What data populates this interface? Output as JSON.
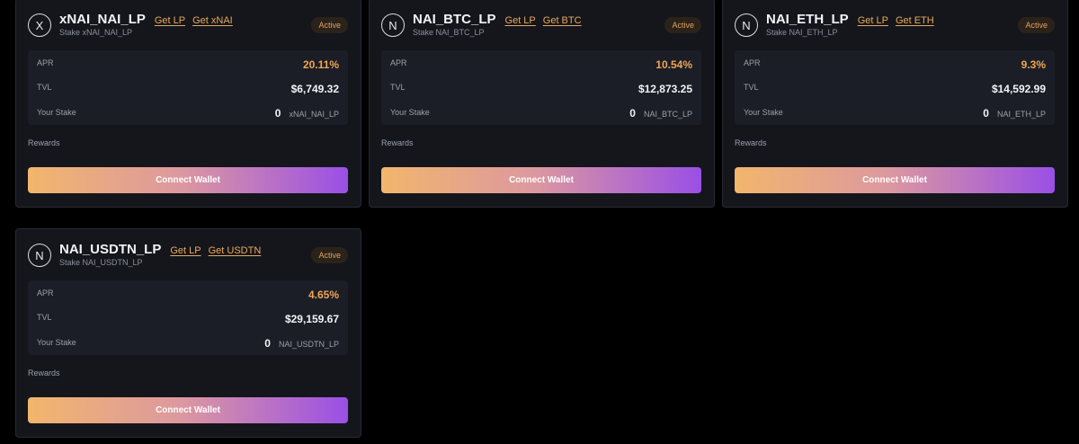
{
  "pools": [
    {
      "icon_letter": "X",
      "icon": "letter-circle-icon",
      "title": "xNAI_NAI_LP",
      "get_lp_label": "Get LP",
      "get_token_label": "Get xNAI",
      "subtitle": "Stake xNAI_NAI_LP",
      "status": "Active",
      "apr_label": "APR",
      "apr_value": "20.11%",
      "tvl_label": "TVL",
      "tvl_value": "$6,749.32",
      "stake_label": "Your Stake",
      "stake_amount": "0",
      "stake_token": "xNAI_NAI_LP",
      "rewards_label": "Rewards",
      "button_label": "Connect Wallet"
    },
    {
      "icon_letter": "N",
      "icon": "letter-circle-icon",
      "title": "NAI_BTC_LP",
      "get_lp_label": "Get LP",
      "get_token_label": "Get BTC",
      "subtitle": "Stake NAI_BTC_LP",
      "status": "Active",
      "apr_label": "APR",
      "apr_value": "10.54%",
      "tvl_label": "TVL",
      "tvl_value": "$12,873.25",
      "stake_label": "Your Stake",
      "stake_amount": "0",
      "stake_token": "NAI_BTC_LP",
      "rewards_label": "Rewards",
      "button_label": "Connect Wallet"
    },
    {
      "icon_letter": "N",
      "icon": "letter-circle-icon",
      "title": "NAI_ETH_LP",
      "get_lp_label": "Get LP",
      "get_token_label": "Get ETH",
      "subtitle": "Stake NAI_ETH_LP",
      "status": "Active",
      "apr_label": "APR",
      "apr_value": "9.3%",
      "tvl_label": "TVL",
      "tvl_value": "$14,592.99",
      "stake_label": "Your Stake",
      "stake_amount": "0",
      "stake_token": "NAI_ETH_LP",
      "rewards_label": "Rewards",
      "button_label": "Connect Wallet"
    },
    {
      "icon_letter": "N",
      "icon": "letter-circle-icon",
      "title": "NAI_USDTN_LP",
      "get_lp_label": "Get LP",
      "get_token_label": "Get USDTN",
      "subtitle": "Stake NAI_USDTN_LP",
      "status": "Active",
      "apr_label": "APR",
      "apr_value": "4.65%",
      "tvl_label": "TVL",
      "tvl_value": "$29,159.67",
      "stake_label": "Your Stake",
      "stake_amount": "0",
      "stake_token": "NAI_USDTN_LP",
      "rewards_label": "Rewards",
      "button_label": "Connect Wallet"
    }
  ],
  "colors": {
    "background": "#000000",
    "card": "#14161c",
    "accent_orange": "#efa553",
    "gradient_start": "#f2b66c",
    "gradient_end": "#9a4fe6"
  }
}
